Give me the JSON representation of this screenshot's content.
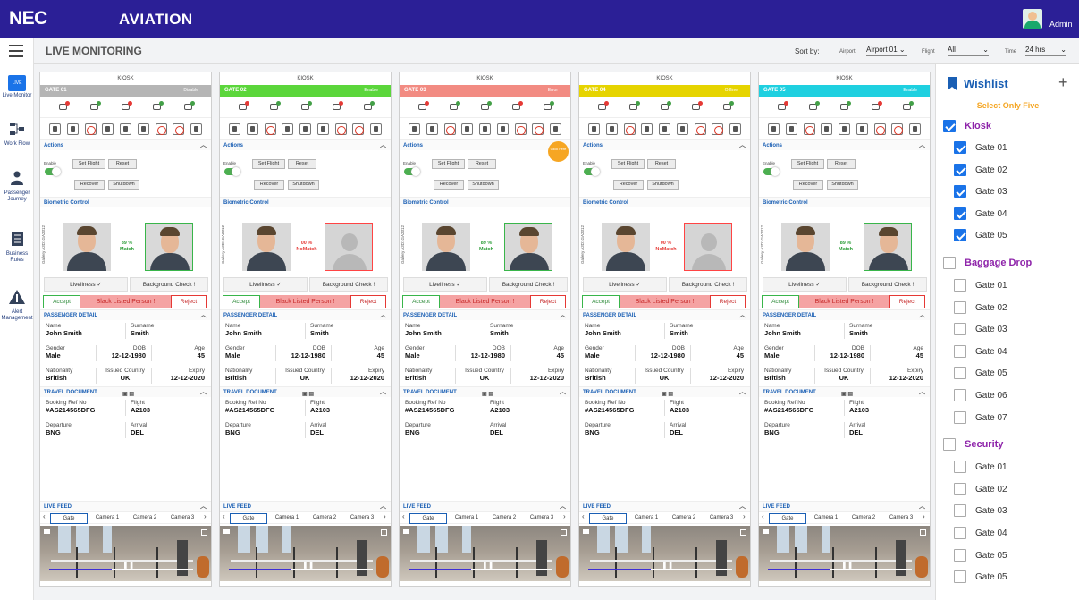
{
  "header": {
    "brand": "NEC",
    "app_title": "AVIATION",
    "user": "Admin"
  },
  "nav": [
    {
      "label": "Live Monitor",
      "badge": "LIVE"
    },
    {
      "label": "Work Flow"
    },
    {
      "label": "Passenger Journey"
    },
    {
      "label": "Business Rules"
    },
    {
      "label": "Alert Management"
    }
  ],
  "page": {
    "title": "LIVE MONITORING"
  },
  "sort": {
    "label": "Sort by:",
    "airport_label": "Airport",
    "airport_value": "Airport 01",
    "flight_label": "Flight",
    "flight_value": "All",
    "time_label": "Time",
    "time_value": "24 hrs"
  },
  "colors": {
    "header": "#2b1f96",
    "gate01": "#b5b5b5",
    "gate02": "#5bd63b",
    "gate03": "#f28b82",
    "gate04": "#e6d400",
    "gate05": "#1fd0e0"
  },
  "card_common": {
    "kiosk": "KIOSK",
    "actions": "Actions",
    "enable": "Enable",
    "set_flight": "Set Flight",
    "reset": "Reset",
    "recover": "Recover",
    "shutdown": "Shutdown",
    "biometric": "Biometric Control",
    "gallery": "Gallery A3D1GA2312",
    "liveliness": "Liveliness ✓",
    "bg_check": "Background Check !",
    "accept": "Accept",
    "blacklisted": "Black Listed Person !",
    "reject": "Reject",
    "passenger_detail": "PASSENGER DETAIL",
    "name_label": "Name",
    "name": "John Smith",
    "surname_label": "Surname",
    "surname": "Smith",
    "gender_label": "Gender",
    "gender": "Male",
    "dob_label": "DOB",
    "dob": "12-12-1980",
    "age_label": "Age",
    "age": "45",
    "nationality_label": "Nationality",
    "nationality": "British",
    "issued_label": "Issued Country",
    "issued": "UK",
    "expiry_label": "Expiry",
    "expiry": "12-12-2020",
    "travel_doc": "TRAVEL DOCUMENT",
    "booking_label": "Booking Ref No",
    "booking": "#AS214565DFG",
    "flight_label": "Flight",
    "flight": "A2103",
    "departure_label": "Departure",
    "departure": "BNG",
    "arrival_label": "Arrival",
    "arrival": "DEL",
    "live_feed": "LIVE FEED",
    "tabs": [
      "Gate",
      "Camera 1",
      "Camera 2",
      "Camera 3"
    ]
  },
  "gates": [
    {
      "name": "GATE 01",
      "status": "Disable",
      "score": "89 %",
      "result": "Match"
    },
    {
      "name": "GATE 02",
      "status": "Enable",
      "score": "00 %",
      "result": "NoMatch"
    },
    {
      "name": "GATE 03",
      "status": "Error",
      "score": "89 %",
      "result": "Match"
    },
    {
      "name": "GATE 04",
      "status": "Offline",
      "score": "00 %",
      "result": "NoMatch"
    },
    {
      "name": "GATE 05",
      "status": "Enable",
      "score": "89 %",
      "result": "Match"
    }
  ],
  "click_here": "Click here",
  "wishlist": {
    "title": "Wishlist",
    "note": "Select Only Five",
    "groups": [
      {
        "name": "Kiosk",
        "checked": true,
        "items": [
          "Gate 01",
          "Gate 02",
          "Gate 03",
          "Gate 04",
          "Gate 05"
        ]
      },
      {
        "name": "Baggage Drop",
        "checked": false,
        "items": [
          "Gate 01",
          "Gate 02",
          "Gate 03",
          "Gate 04",
          "Gate 05",
          "Gate 06",
          "Gate 07"
        ]
      },
      {
        "name": "Security",
        "checked": false,
        "items": [
          "Gate 01",
          "Gate 02",
          "Gate 03",
          "Gate 04",
          "Gate 05",
          "Gate 05"
        ]
      }
    ]
  }
}
